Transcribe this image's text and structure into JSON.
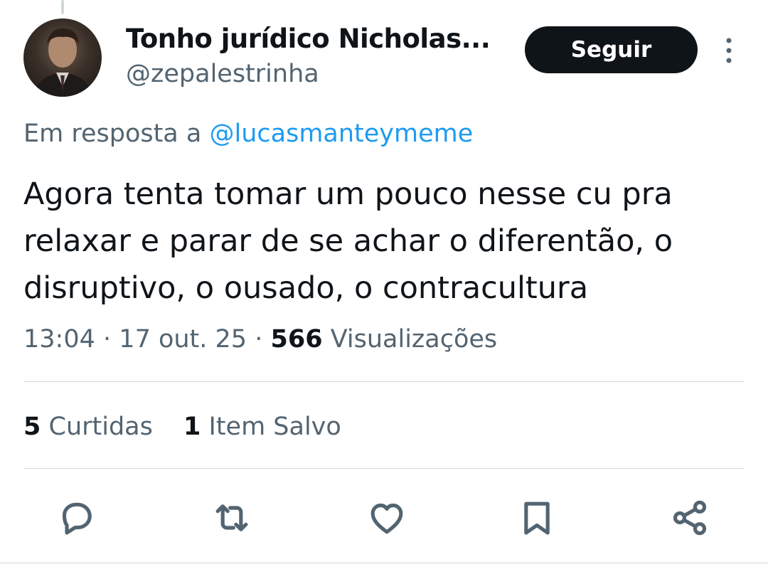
{
  "tweet": {
    "author": {
      "display_name": "Tonho jurídico Nicholas...",
      "handle": "@zepalestrinha"
    },
    "follow_label": "Seguir",
    "reply_prefix": "Em resposta a",
    "reply_to": "@lucasmanteymeme",
    "text": "Agora tenta tomar um pouco nesse cu pra relaxar e parar de se achar o diferentão, o disruptivo, o ousado, o contracultura",
    "time": "13:04",
    "date": "17 out. 25",
    "sep": "·",
    "views_count": "566",
    "views_label": "Visualizações",
    "likes_count": "5",
    "likes_label": "Curtidas",
    "saves_count": "1",
    "saves_label": "Item Salvo"
  },
  "actions": {
    "reply_icon": "reply-icon",
    "retweet_icon": "retweet-icon",
    "like_icon": "heart-icon",
    "bookmark_icon": "bookmark-icon",
    "share_icon": "share-icon"
  },
  "colors": {
    "text_primary": "#0f1419",
    "text_secondary": "#536471",
    "link": "#1d9bf0",
    "divider": "#cfd9de",
    "button_bg": "#0f1419"
  }
}
